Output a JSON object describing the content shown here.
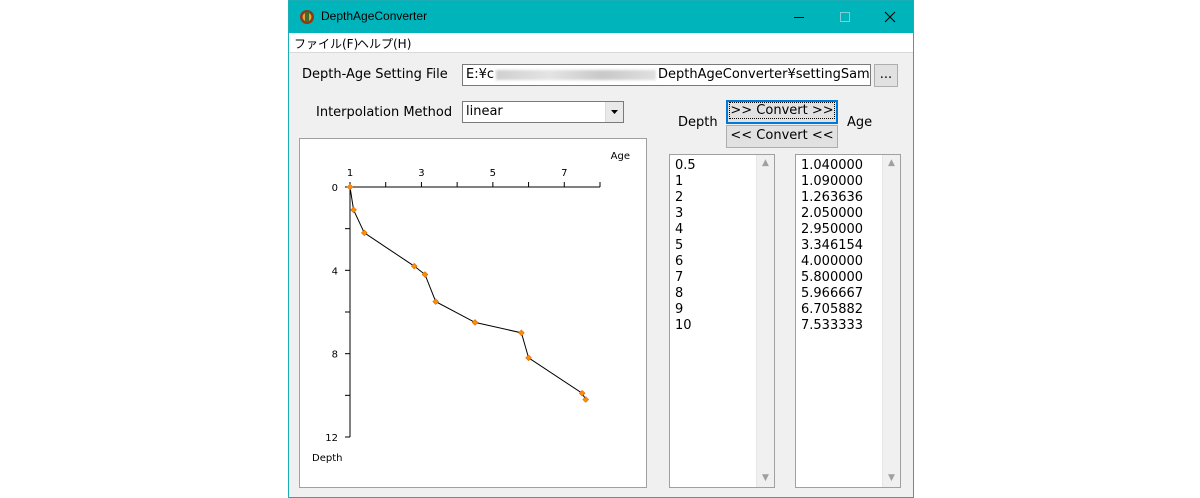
{
  "window": {
    "title": "DepthAgeConverter",
    "accent": "#00b4bc"
  },
  "menu": {
    "file": "ファイル(F)",
    "help": "ヘルプ(H)"
  },
  "settings": {
    "file_label": "Depth-Age Setting File",
    "file_path_prefix": "E:¥c",
    "file_path_suffix": "DepthAgeConverter¥settingSamp",
    "browse_label": "...",
    "method_label": "Interpolation Method",
    "method_value": "linear"
  },
  "convert": {
    "depth_label": "Depth",
    "age_label": "Age",
    "to_age_button": ">> Convert >>",
    "to_depth_button": "<< Convert <<"
  },
  "lists": {
    "depth": [
      "0.5",
      "1",
      "2",
      "3",
      "4",
      "5",
      "6",
      "7",
      "8",
      "9",
      "10"
    ],
    "age": [
      "1.040000",
      "1.090000",
      "1.263636",
      "2.050000",
      "2.950000",
      "3.346154",
      "4.000000",
      "5.800000",
      "5.966667",
      "6.705882",
      "7.533333"
    ]
  },
  "chart_data": {
    "type": "scatter",
    "xlabel": "Age",
    "ylabel": "Depth",
    "x_ticks": [
      "1",
      "3",
      "5",
      "7"
    ],
    "y_ticks": [
      "0",
      "4",
      "8",
      "12"
    ],
    "xlim": [
      1,
      8
    ],
    "ylim": [
      0,
      12
    ],
    "y_inverted": true,
    "marker_color": "#ff8c00",
    "line_color": "#000000",
    "points": [
      {
        "x": 1.0,
        "y": 0.0
      },
      {
        "x": 1.1,
        "y": 1.1
      },
      {
        "x": 1.4,
        "y": 2.2
      },
      {
        "x": 2.8,
        "y": 3.8
      },
      {
        "x": 3.1,
        "y": 4.2
      },
      {
        "x": 3.4,
        "y": 5.5
      },
      {
        "x": 4.5,
        "y": 6.5
      },
      {
        "x": 5.8,
        "y": 7.0
      },
      {
        "x": 6.0,
        "y": 8.2
      },
      {
        "x": 7.5,
        "y": 9.9
      },
      {
        "x": 7.6,
        "y": 10.2
      }
    ]
  }
}
